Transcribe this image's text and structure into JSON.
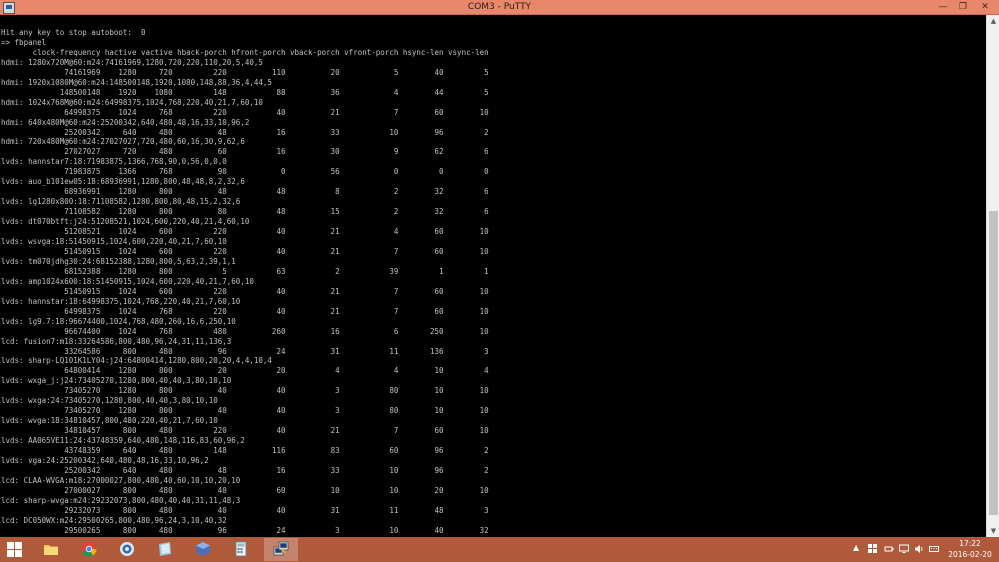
{
  "window": {
    "title": "COM3 - PuTTY",
    "buttons": {
      "minimize": "—",
      "maximize": "❐",
      "close": "✕"
    }
  },
  "terminal": {
    "lines": [
      "Hit any key to stop autoboot:  0",
      "=> fbpanel",
      "       clock-frequency hactive vactive hback-porch hfront-porch vback-porch vfront-porch hsync-len vsync-len",
      "hdmi: 1280x720M@60:m24:74161969,1280,720,220,110,20,5,40,5",
      "              74161969    1280     720         220          110          20            5        40         5",
      "hdmi: 1920x1080M@60:m24:148500148,1920,1080,148,88,36,4,44,5",
      "             148500148    1920    1080         148           88          36            4        44         5",
      "hdmi: 1024x768M@60:m24:64998375,1024,768,220,40,21,7,60,10",
      "              64998375    1024     768         220           40          21            7        60        10",
      "hdmi: 640x480M@60:m24:25200342,640,480,48,16,33,10,96,2",
      "              25200342     640     480          48           16          33           10        96         2",
      "hdmi: 720x480M@60:m24:27027027,720,480,60,16,30,9,62,6",
      "              27027027     720     480          60           16          30            9        62         6",
      "lvds: hannstar7:18:71983875,1366,768,90,0,56,0,0,0",
      "              71983875    1366     768          90            0          56            0         0         0",
      "lvds: auo_b101ew05:18:68936991,1280,800,48,48,8,2,32,6",
      "              68936991    1280     800          48           48           8            2        32         6",
      "lvds: lg1280x800:18:71108582,1280,800,80,48,15,2,32,6",
      "              71108582    1280     800          80           48          15            2        32         6",
      "lvds: dt070btft:j24:51208521,1024,600,220,40,21,4,60,10",
      "              51208521    1024     600         220           40          21            4        60        10",
      "lvds: wsvga:18:51450915,1024,600,220,40,21,7,60,10",
      "              51450915    1024     600         220           40          21            7        60        10",
      "lvds: tm070jdhg30:24:68152388,1280,800,5,63,2,39,1,1",
      "              68152388    1280     800           5           63           2           39         1         1",
      "lvds: amp1024x600:18:51450915,1024,600,220,40,21,7,60,10",
      "              51450915    1024     600         220           40          21            7        60        10",
      "lvds: hannstar:18:64998375,1024,768,220,40,21,7,60,10",
      "              64998375    1024     768         220           40          21            7        60        10",
      "lvds: lg9.7:18:96674400,1024,768,480,260,16,6,250,10",
      "              96674400    1024     768         480          260          16            6       250        10",
      "lcd: fusion7:m18:33264586,800,480,96,24,31,11,136,3",
      "              33264586     800     480          96           24          31           11       136         3",
      "lvds: sharp-LQ101K1LY04:j24:64800414,1280,800,20,20,4,4,10,4",
      "              64800414    1280     800          20           20           4            4        10         4",
      "lvds: wxga_j:j24:73405270,1280,800,40,40,3,80,10,10",
      "              73405270    1280     800          40           40           3           80        10        10",
      "lvds: wxga:24:73405270,1280,800,40,40,3,80,10,10",
      "              73405270    1280     800          40           40           3           80        10        10",
      "lvds: wvga:18:34810457,800,480,220,40,21,7,60,10",
      "              34810457     800     480         220           40          21            7        60        10",
      "lvds: AA065VE11:24:43748359,640,480,148,116,83,60,96,2",
      "              43748359     640     480         148          116          83           60        96         2",
      "lvds: vga:24:25200342,640,480,48,16,33,10,96,2",
      "              25200342     640     480          48           16          33           10        96         2",
      "lcd: CLAA-WVGA:m18:27000027,800,480,40,60,10,10,20,10",
      "              27000027     800     480          40           60          10           10        20        10",
      "lcd: sharp-wvga:m24:29232073,800,480,40,40,31,11,48,3",
      "              29232073     800     480          40           40          31           11        48         3",
      "lcd: DC050WX:m24:29500265,800,480,96,24,3,10,40,32",
      "              29500265     800     480          96           24           3           10        40        32"
    ]
  },
  "scrollbar": {
    "up_arrow": "▲",
    "down_arrow": "▼",
    "thumb_position": 0.37,
    "thumb_size": 0.61
  },
  "taskbar": {
    "apps": [
      {
        "name": "start",
        "icon": "windows-logo-icon"
      },
      {
        "name": "file-explorer",
        "icon": "folder-icon"
      },
      {
        "name": "chrome",
        "icon": "chrome-icon"
      },
      {
        "name": "outlook",
        "icon": "outlook-icon"
      },
      {
        "name": "app",
        "icon": "book-icon"
      },
      {
        "name": "virtualbox",
        "icon": "virtualbox-icon"
      },
      {
        "name": "calculator",
        "icon": "calculator-icon"
      },
      {
        "name": "putty",
        "icon": "putty-icon",
        "active": true
      }
    ],
    "tray_arrow": "▲",
    "clock": {
      "time": "17:22",
      "date": "2016-02-20"
    },
    "colors": {
      "taskbar": "#b05a3c",
      "titlebar": "#e8876b"
    }
  }
}
